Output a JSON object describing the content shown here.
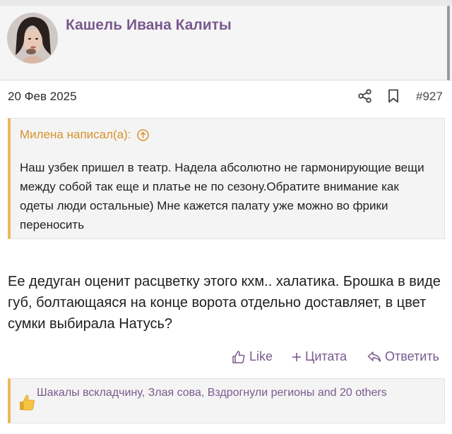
{
  "header": {
    "username": "Кашель Ивана Калиты"
  },
  "post": {
    "date": "20 Фев 2025",
    "number": "#927",
    "quote": {
      "author": "Милена написал(а):",
      "text": "Наш узбек пришел в театр. Надела абсолютно не гармонирующие вещи между собой так еще и платье не по сезону.Обратите внимание как одеты люди остальные) Мне кажется палату уже можно во фрики переносить"
    },
    "body": "Ее дедуган оценит расцветку этого кхм.. халатика. Брошка в виде губ, болтающаяся на конце ворота отдельно доставляет, в цвет сумки выбирала Натусь?",
    "actions": {
      "like": "Like",
      "quote": "Цитата",
      "reply": "Ответить"
    },
    "likes_text": "Шакалы вскладчину, Злая сова, Вздрогнули регионы and 20 others"
  },
  "colors": {
    "accent": "#7a5a8e",
    "quote_border": "#f0b85a",
    "quote_author": "#d8922c"
  }
}
